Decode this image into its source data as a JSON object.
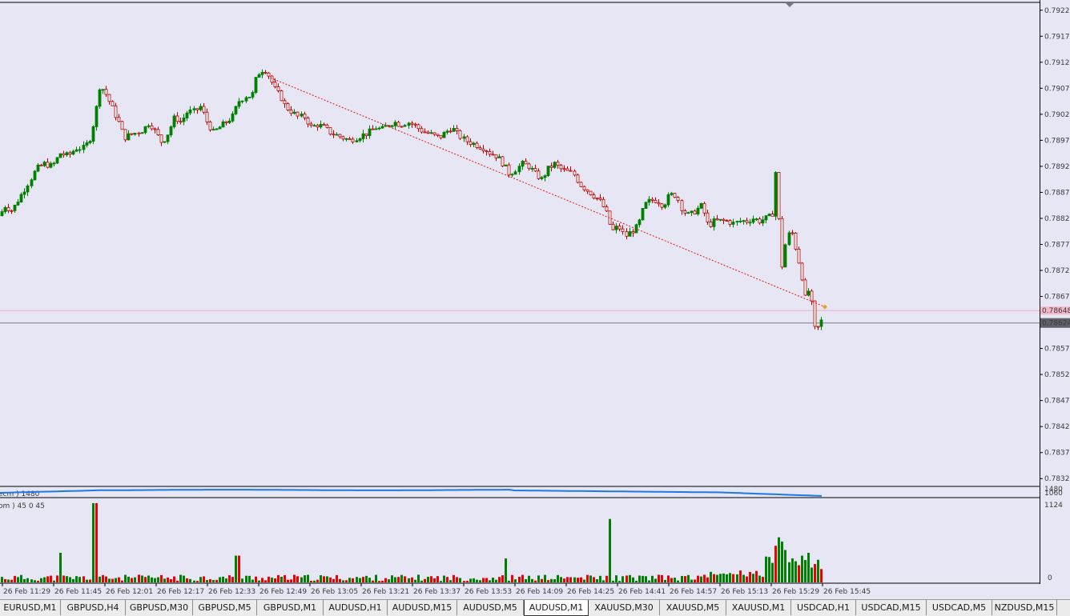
{
  "chart_data": {
    "type": "candlestick",
    "symbol": "AUDUSD",
    "timeframe": "M1",
    "price_axis_labels": [
      "0.79225",
      "0.79175",
      "0.79125",
      "0.79075",
      "0.79025",
      "0.78975",
      "0.78925",
      "0.78875",
      "0.78825",
      "0.78775",
      "0.78725",
      "0.78675",
      "0.78575",
      "0.78525",
      "0.78475",
      "0.78425",
      "0.78375",
      "0.78325"
    ],
    "current_price_label": "0.78624",
    "ask_line_label": "0.78648",
    "y_range": [
      0.7831,
      0.7924
    ],
    "close_path": [
      [
        0,
        0.7883
      ],
      [
        5,
        0.7885
      ],
      [
        15,
        0.7884
      ],
      [
        30,
        0.7888
      ],
      [
        45,
        0.7892
      ],
      [
        55,
        0.7893
      ],
      [
        65,
        0.78925
      ],
      [
        75,
        0.7895
      ],
      [
        85,
        0.78945
      ],
      [
        95,
        0.7896
      ],
      [
        105,
        0.7896
      ],
      [
        112,
        0.7898
      ],
      [
        118,
        0.7902
      ],
      [
        124,
        0.7908
      ],
      [
        130,
        0.7907
      ],
      [
        136,
        0.7905
      ],
      [
        142,
        0.7903
      ],
      [
        148,
        0.7901
      ],
      [
        155,
        0.7898
      ],
      [
        162,
        0.78985
      ],
      [
        170,
        0.7899
      ],
      [
        178,
        0.78995
      ],
      [
        186,
        0.7901
      ],
      [
        194,
        0.7899
      ],
      [
        202,
        0.7897
      ],
      [
        210,
        0.7899
      ],
      [
        218,
        0.7902
      ],
      [
        226,
        0.7901
      ],
      [
        234,
        0.7903
      ],
      [
        242,
        0.7903
      ],
      [
        250,
        0.7904
      ],
      [
        258,
        0.7901
      ],
      [
        266,
        0.7899
      ],
      [
        274,
        0.79
      ],
      [
        282,
        0.7901
      ],
      [
        290,
        0.7902
      ],
      [
        298,
        0.7905
      ],
      [
        306,
        0.7906
      ],
      [
        314,
        0.7906
      ],
      [
        320,
        0.791
      ],
      [
        326,
        0.7911
      ],
      [
        332,
        0.7911
      ],
      [
        338,
        0.7909
      ],
      [
        344,
        0.7907
      ],
      [
        350,
        0.7906
      ],
      [
        356,
        0.7904
      ],
      [
        364,
        0.7903
      ],
      [
        372,
        0.7902
      ],
      [
        380,
        0.7902
      ],
      [
        388,
        0.79
      ],
      [
        396,
        0.79005
      ],
      [
        404,
        0.79
      ],
      [
        412,
        0.7899
      ],
      [
        420,
        0.78985
      ],
      [
        428,
        0.7898
      ],
      [
        436,
        0.78975
      ],
      [
        444,
        0.7898
      ],
      [
        452,
        0.78985
      ],
      [
        460,
        0.7899
      ],
      [
        468,
        0.79
      ],
      [
        476,
        0.78995
      ],
      [
        484,
        0.79005
      ],
      [
        492,
        0.7901
      ],
      [
        500,
        0.79005
      ],
      [
        508,
        0.7901
      ],
      [
        516,
        0.79005
      ],
      [
        524,
        0.78995
      ],
      [
        532,
        0.7899
      ],
      [
        540,
        0.78985
      ],
      [
        548,
        0.7898
      ],
      [
        556,
        0.7899
      ],
      [
        564,
        0.79
      ],
      [
        572,
        0.78985
      ],
      [
        580,
        0.78975
      ],
      [
        588,
        0.7897
      ],
      [
        596,
        0.78965
      ],
      [
        604,
        0.7896
      ],
      [
        612,
        0.7895
      ],
      [
        620,
        0.78945
      ],
      [
        628,
        0.7893
      ],
      [
        636,
        0.7891
      ],
      [
        644,
        0.7892
      ],
      [
        652,
        0.7893
      ],
      [
        660,
        0.78925
      ],
      [
        668,
        0.7891
      ],
      [
        676,
        0.789
      ],
      [
        684,
        0.7892
      ],
      [
        692,
        0.7893
      ],
      [
        700,
        0.7892
      ],
      [
        708,
        0.78915
      ],
      [
        716,
        0.7891
      ],
      [
        724,
        0.7889
      ],
      [
        732,
        0.7888
      ],
      [
        740,
        0.7887
      ],
      [
        748,
        0.7886
      ],
      [
        756,
        0.7884
      ],
      [
        764,
        0.788
      ],
      [
        772,
        0.7881
      ],
      [
        780,
        0.7879
      ],
      [
        788,
        0.788
      ],
      [
        796,
        0.7881
      ],
      [
        804,
        0.7885
      ],
      [
        812,
        0.7886
      ],
      [
        820,
        0.7886
      ],
      [
        828,
        0.7885
      ],
      [
        836,
        0.7887
      ],
      [
        844,
        0.7887
      ],
      [
        852,
        0.7884
      ],
      [
        860,
        0.7883
      ],
      [
        868,
        0.7884
      ],
      [
        876,
        0.7885
      ],
      [
        884,
        0.7881
      ],
      [
        892,
        0.7882
      ],
      [
        900,
        0.7882
      ],
      [
        908,
        0.7882
      ],
      [
        916,
        0.78815
      ],
      [
        924,
        0.7882
      ],
      [
        932,
        0.7882
      ],
      [
        940,
        0.78825
      ],
      [
        948,
        0.7882
      ],
      [
        956,
        0.78825
      ],
      [
        964,
        0.7883
      ],
      [
        968,
        0.7892
      ],
      [
        972,
        0.7883
      ],
      [
        976,
        0.7873
      ],
      [
        982,
        0.7879
      ],
      [
        988,
        0.788
      ],
      [
        994,
        0.7876
      ],
      [
        1000,
        0.7872
      ],
      [
        1005,
        0.7867
      ],
      [
        1010,
        0.7869
      ],
      [
        1014,
        0.7865
      ],
      [
        1018,
        0.786
      ],
      [
        1022,
        0.7862
      ],
      [
        1026,
        0.7863
      ]
    ],
    "trendline": {
      "from": [
        338,
        0.79095
      ],
      "to": [
        1030,
        0.78655
      ],
      "color": "#EE1111",
      "style": "dotted"
    },
    "indicator_panel": {
      "label_left": "ecm ) 1480",
      "right_labels": [
        "1480",
        "1060"
      ],
      "line_color": "#1E78E6"
    },
    "volume_panel": {
      "label": "om ) 45 0 45",
      "max_label": "1124",
      "zero_label": "0",
      "max_value": 1124,
      "colors": {
        "up": "#008000",
        "down": "#EE0000"
      }
    },
    "time_labels": [
      "26 Feb 11:29",
      "26 Feb 11:45",
      "26 Feb 12:01",
      "26 Feb 12:17",
      "26 Feb 12:33",
      "26 Feb 12:49",
      "26 Feb 13:05",
      "26 Feb 13:21",
      "26 Feb 13:37",
      "26 Feb 13:53",
      "26 Feb 14:09",
      "26 Feb 14:25",
      "26 Feb 14:41",
      "26 Feb 14:57",
      "26 Feb 15:13",
      "26 Feb 15:29",
      "26 Feb 15:45"
    ],
    "colors": {
      "background": "#E6E6F5",
      "bull": "#008000",
      "bear": "#BB0000",
      "grid_axis": "#000000"
    }
  },
  "tabs": [
    {
      "label": "EURUSD,M1",
      "active": false
    },
    {
      "label": "GBPUSD,H4",
      "active": false
    },
    {
      "label": "GBPUSD,M30",
      "active": false
    },
    {
      "label": "GBPUSD,M5",
      "active": false
    },
    {
      "label": "GBPUSD,M1",
      "active": false
    },
    {
      "label": "AUDUSD,H1",
      "active": false
    },
    {
      "label": "AUDUSD,M15",
      "active": false
    },
    {
      "label": "AUDUSD,M5",
      "active": false
    },
    {
      "label": "AUDUSD,M1",
      "active": true
    },
    {
      "label": "XAUUSD,M30",
      "active": false
    },
    {
      "label": "XAUUSD,M5",
      "active": false
    },
    {
      "label": "XAUUSD,M1",
      "active": false
    },
    {
      "label": "USDCAD,H1",
      "active": false
    },
    {
      "label": "USDCAD,M15",
      "active": false
    },
    {
      "label": "USDCAD,M5",
      "active": false
    },
    {
      "label": "NZDUSD,M15",
      "active": false
    }
  ]
}
